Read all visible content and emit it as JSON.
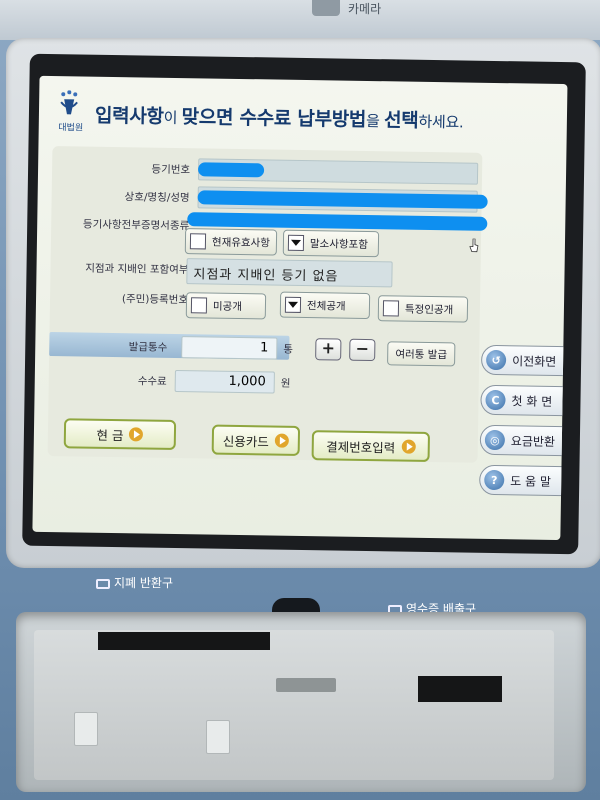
{
  "kiosk": {
    "camera_label": "카메라",
    "bill_return_label": "지폐 반환구",
    "receipt_label": "영수증 배출구"
  },
  "screen": {
    "logo_text": "대법원",
    "title_parts": [
      "입력사항",
      "이 ",
      "맞으면",
      " ",
      "수수료",
      " ",
      "납부방법",
      "을 ",
      "선택",
      "하세요."
    ],
    "form": {
      "reg_no_label": "등기번호",
      "name_label": "상호/명칭/성명",
      "cert_type_label": "등기사항전부증명서종류",
      "opt_current": "현재유효사항",
      "opt_cancelled": "말소사항포함",
      "branch_label": "지점과 지배인 포함여부",
      "branch_value": "지점과 지배인 등기 없음",
      "id_label": "(주민)등록번호",
      "opt_private": "미공개",
      "opt_full": "전체공개",
      "opt_specific": "특정인공개",
      "copies_label": "발급통수",
      "copies_value": "1",
      "copies_unit": "통",
      "plus": "+",
      "minus": "−",
      "multi_btn": "여러통 발급",
      "fee_label": "수수료",
      "fee_value": "1,000",
      "fee_unit": "원"
    },
    "pay": {
      "cash": "현 금",
      "card": "신용카드",
      "code": "결제번호입력"
    },
    "side": {
      "prev": "이전화면",
      "first": "첫 화 면",
      "refund": "요금반환",
      "help": "도 움 말"
    }
  },
  "colors": {
    "title": "#153a6e",
    "redaction": "#0e8ff0",
    "accent_green": "#8fa63f"
  }
}
